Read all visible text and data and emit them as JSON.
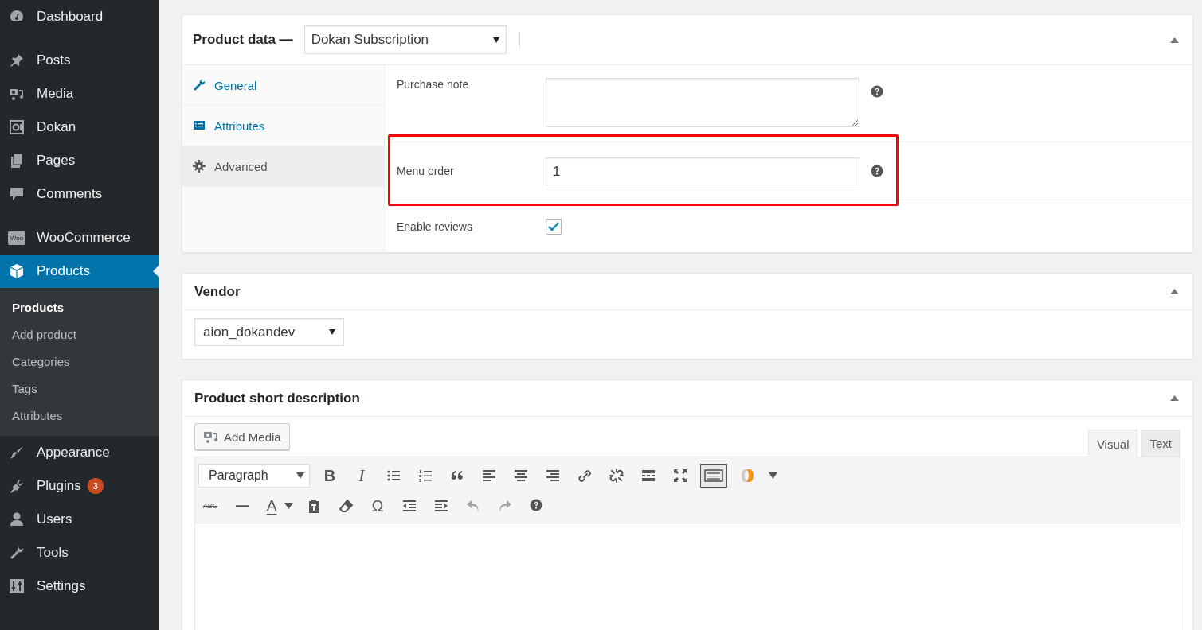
{
  "sidebar": {
    "groups": [
      [
        {
          "label": "Dashboard",
          "selected": false
        }
      ],
      [
        {
          "label": "Posts",
          "selected": false
        },
        {
          "label": "Media",
          "selected": false
        },
        {
          "label": "Dokan",
          "selected": false
        },
        {
          "label": "Pages",
          "selected": false
        },
        {
          "label": "Comments",
          "selected": false
        }
      ],
      [
        {
          "label": "WooCommerce",
          "selected": false,
          "logo_text": "Woo"
        },
        {
          "label": "Products",
          "selected": true,
          "submenu": [
            {
              "label": "Products",
              "selected": true
            },
            {
              "label": "Add product",
              "selected": false
            },
            {
              "label": "Categories",
              "selected": false
            },
            {
              "label": "Tags",
              "selected": false
            },
            {
              "label": "Attributes",
              "selected": false
            }
          ]
        },
        {
          "label": "Appearance",
          "selected": false
        },
        {
          "label": "Plugins",
          "selected": false,
          "badge": "3"
        },
        {
          "label": "Users",
          "selected": false
        },
        {
          "label": "Tools",
          "selected": false
        },
        {
          "label": "Settings",
          "selected": false
        }
      ]
    ]
  },
  "product_data": {
    "title": "Product data —",
    "type_select": "Dokan Subscription",
    "expanded": true,
    "tabs": [
      {
        "label": "General",
        "selected": false
      },
      {
        "label": "Attributes",
        "selected": false
      },
      {
        "label": "Advanced",
        "selected": true
      }
    ],
    "fields": [
      {
        "kind": "textarea",
        "label": "Purchase note",
        "help": true,
        "highlighted": false
      },
      {
        "kind": "number",
        "label": "Menu order",
        "value": "1",
        "help": true,
        "highlighted": true
      },
      {
        "kind": "checkbox",
        "label": "Enable reviews",
        "checked": true,
        "help": false,
        "highlighted": false
      }
    ]
  },
  "vendor": {
    "title": "Vendor",
    "expanded": true,
    "select": "aion_dokandev"
  },
  "short_description": {
    "title": "Product short description",
    "expanded": true,
    "add_media": "Add Media",
    "editor_tabs": [
      {
        "label": "Visual",
        "selected": true
      },
      {
        "label": "Text",
        "selected": false
      }
    ],
    "toolbar": [
      [
        {
          "kind": "select",
          "text": "Paragraph"
        },
        {
          "kind": "bold",
          "text": "B"
        },
        {
          "kind": "italic",
          "text": "I"
        },
        {
          "kind": "icon"
        },
        {
          "kind": "icon"
        },
        {
          "kind": "icon"
        },
        {
          "kind": "icon"
        },
        {
          "kind": "icon"
        },
        {
          "kind": "icon"
        },
        {
          "kind": "icon"
        },
        {
          "kind": "icon"
        },
        {
          "kind": "icon"
        },
        {
          "kind": "icon"
        },
        {
          "kind": "toggle",
          "pressed": true
        },
        {
          "kind": "icon"
        },
        {
          "kind": "caret"
        }
      ],
      [
        {
          "kind": "strike",
          "text": "ABC"
        },
        {
          "kind": "icon"
        },
        {
          "kind": "color",
          "text": "A"
        },
        {
          "kind": "caret"
        },
        {
          "kind": "icon"
        },
        {
          "kind": "icon"
        },
        {
          "kind": "glyph",
          "text": "Ω"
        },
        {
          "kind": "icon"
        },
        {
          "kind": "icon"
        },
        {
          "kind": "undo",
          "disabled": true
        },
        {
          "kind": "redo",
          "disabled": true
        },
        {
          "kind": "icon"
        }
      ]
    ]
  }
}
